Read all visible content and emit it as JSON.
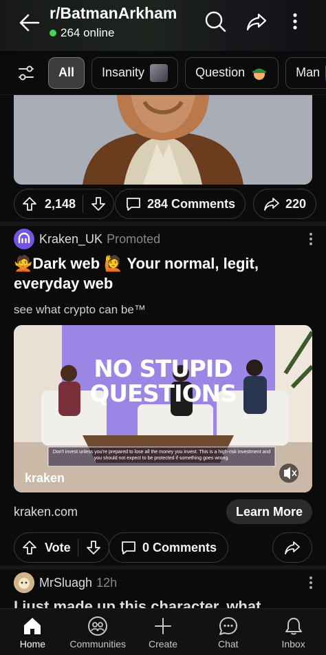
{
  "header": {
    "subreddit": "r/BatmanArkham",
    "online": "264 online"
  },
  "filters": [
    "All",
    "Insanity",
    "Question",
    "Man"
  ],
  "post1": {
    "upvotes": "2,148",
    "comments": "284 Comments",
    "shares": "220"
  },
  "ad": {
    "author": "Kraken_UK",
    "tag": "Promoted",
    "title_line1": "🙅Dark web 🙋 Your normal, legit,",
    "title_line2": "everyday web",
    "subtitle": "see what crypto can be™",
    "media_headline_1": "NO STUPID",
    "media_headline_2": "QUESTIONS",
    "disclaimer": "Don't invest unless you're prepared to lose all the money you invest. This is a high-risk investment and you should not expect to be protected if something goes wrong.",
    "brand": "kraken",
    "domain": "kraken.com",
    "cta": "Learn More",
    "vote_label": "Vote",
    "comments": "0 Comments"
  },
  "post3": {
    "author": "MrSluagh",
    "age": "12h",
    "title": "I just made up this character, what"
  },
  "nav": {
    "home": "Home",
    "communities": "Communities",
    "create": "Create",
    "chat": "Chat",
    "inbox": "Inbox"
  }
}
